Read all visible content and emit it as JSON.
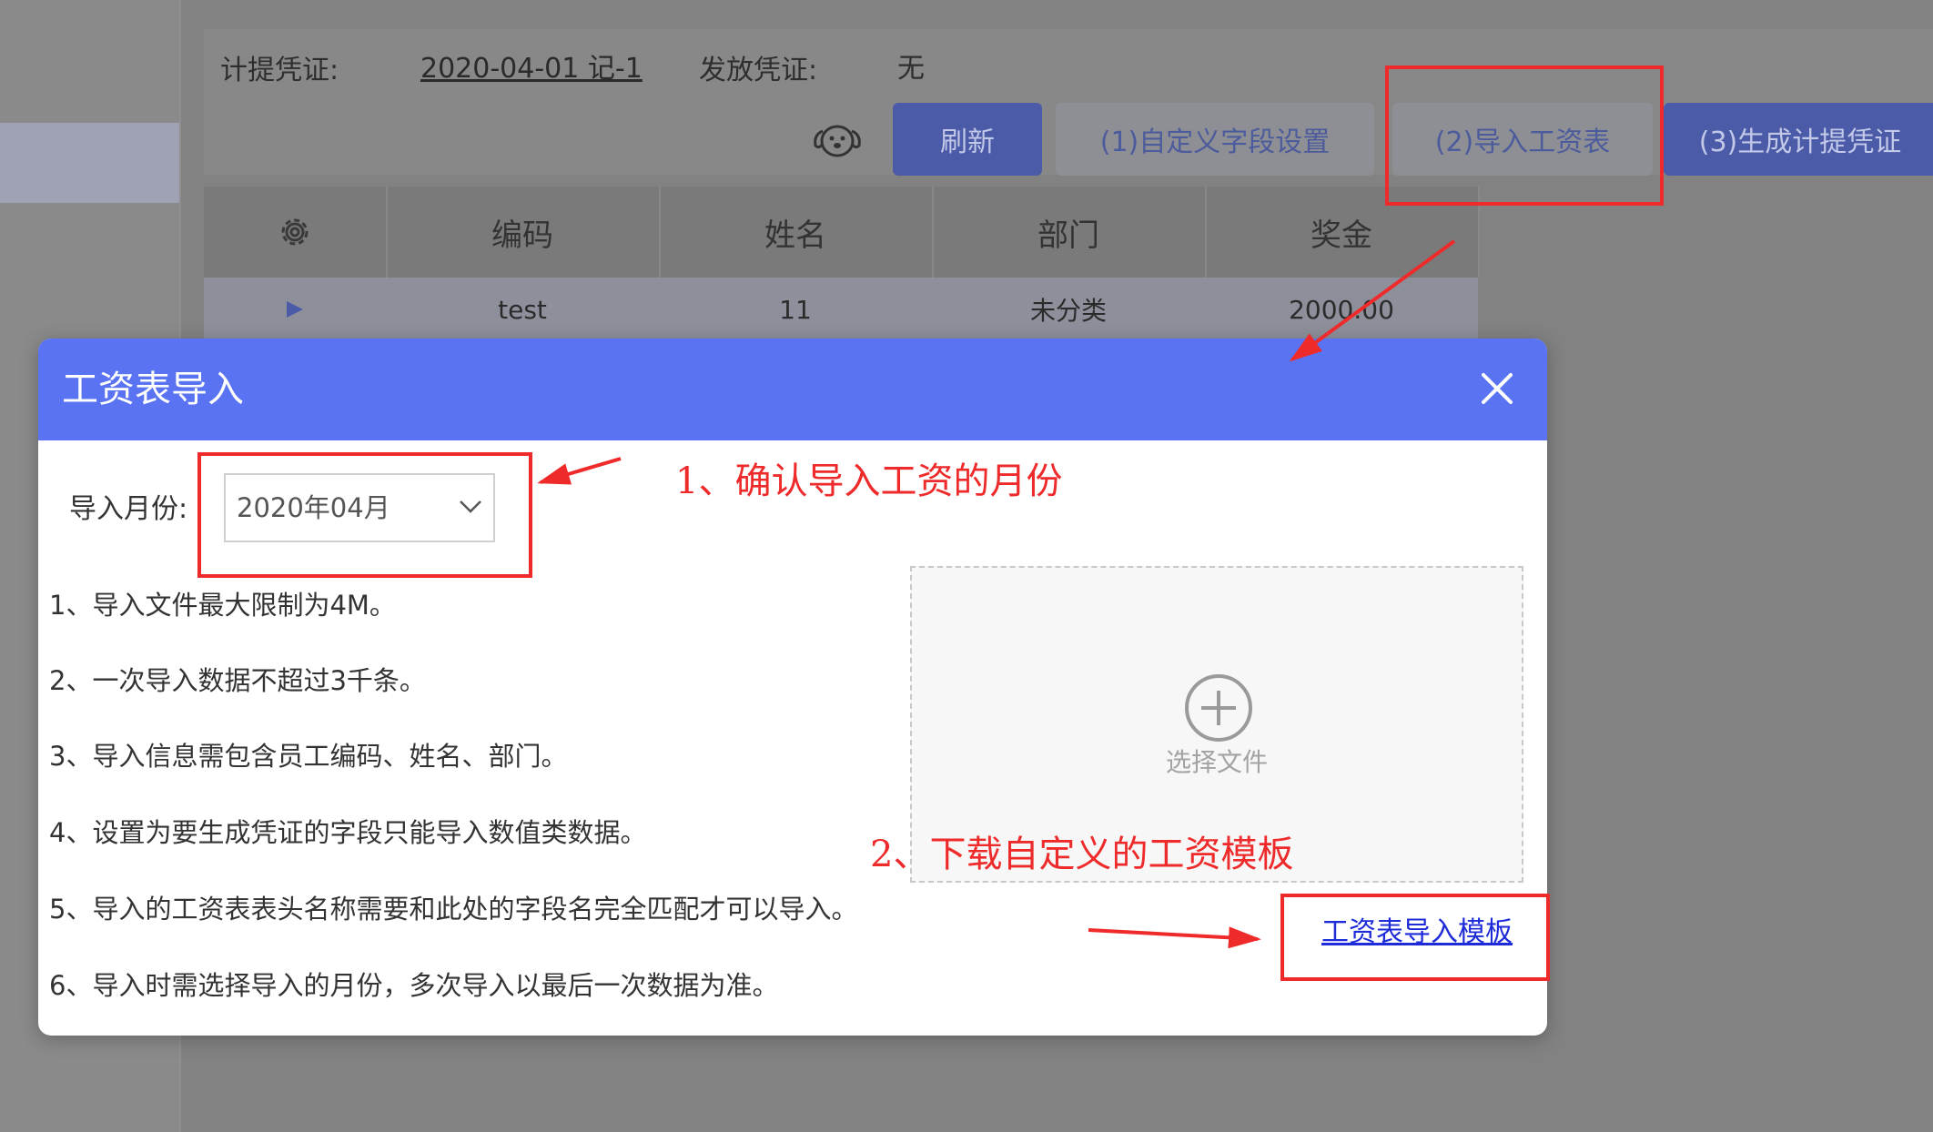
{
  "background": {
    "voucher": {
      "accrual_label": "计提凭证:",
      "accrual_value": "2020-04-01 记-1",
      "issue_label": "发放凭证:",
      "issue_value": "无"
    },
    "toolbar": {
      "refresh": "刷新",
      "custom_fields": "(1)自定义字段设置",
      "import_salary": "(2)导入工资表",
      "generate_voucher": "(3)生成计提凭证"
    },
    "table": {
      "headers": [
        "编码",
        "姓名",
        "部门",
        "奖金"
      ],
      "row": [
        "test",
        "11",
        "未分类",
        "2000.00"
      ]
    }
  },
  "modal": {
    "title": "工资表导入",
    "month_label": "导入月份:",
    "month_value": "2020年04月",
    "rules": [
      "1、导入文件最大限制为4M。",
      "2、一次导入数据不超过3千条。",
      "3、导入信息需包含员工编码、姓名、部门。",
      "4、设置为要生成凭证的字段只能导入数值类数据。",
      "5、导入的工资表表头名称需要和此处的字段名完全匹配才可以导入。",
      "6、导入时需选择导入的月份，多次导入以最后一次数据为准。"
    ],
    "upload_text": "选择文件",
    "template_link": "工资表导入模板"
  },
  "annotations": {
    "step1": "1、确认导入工资的月份",
    "step2": "2、下载自定义的工资模板"
  },
  "colors": {
    "modal_header": "#5a73f2",
    "primary_button": "#4b5ba8",
    "annotation_red": "#ee2a2a",
    "link": "#1d2bd8"
  },
  "icons": [
    "gear-icon",
    "dog-icon",
    "play-icon",
    "close-icon",
    "chevron-down-icon",
    "plus-circle-icon"
  ]
}
